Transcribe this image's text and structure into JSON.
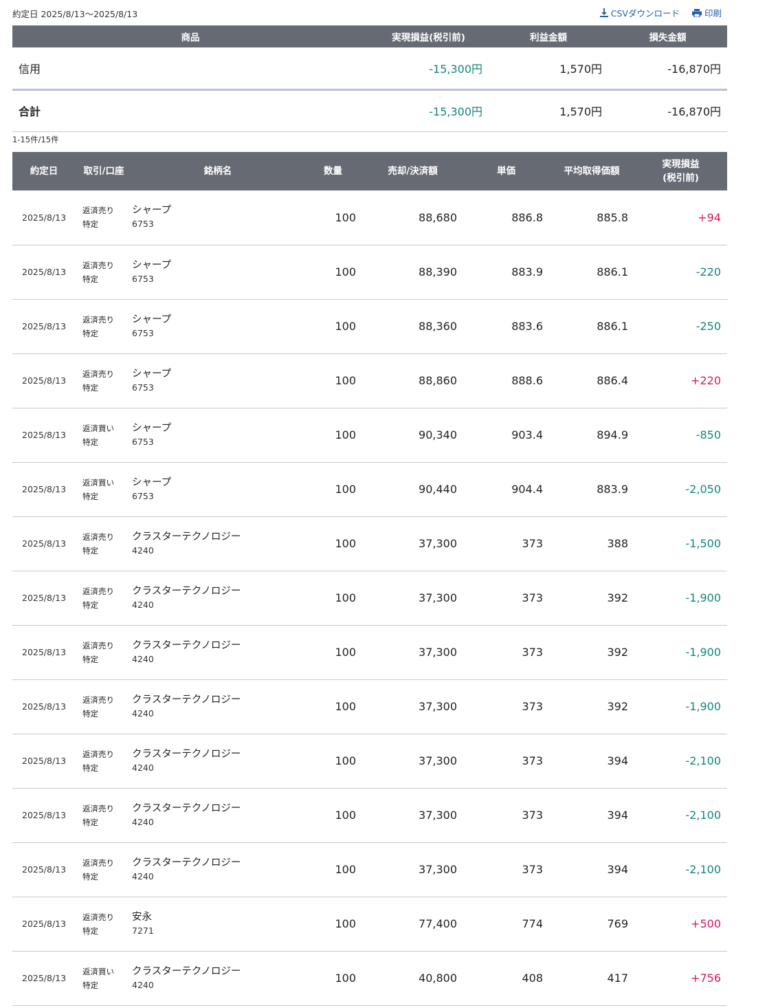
{
  "header": {
    "period": "約定日 2025/8/13〜2025/8/13",
    "csv_label": "CSVダウンロード",
    "print_label": "印刷"
  },
  "summary": {
    "columns": [
      "商品",
      "実現損益(税引前)",
      "利益金額",
      "損失金額"
    ],
    "rows": [
      {
        "label": "信用",
        "realized": "-15,300円",
        "profit": "1,570円",
        "loss": "-16,870円"
      }
    ],
    "total": {
      "label": "合計",
      "realized": "-15,300円",
      "profit": "1,570円",
      "loss": "-16,870円"
    }
  },
  "result_count": "1-15件/15件",
  "detail": {
    "columns": {
      "date": "約定日",
      "type": "取引/口座",
      "name": "銘柄名",
      "qty": "数量",
      "amount": "売却/決済額",
      "price": "単価",
      "avg": "平均取得価額",
      "pl_line1": "実現損益",
      "pl_line2": "(税引前)"
    },
    "rows": [
      {
        "date": "2025/8/13",
        "trade": "返済売り",
        "account": "特定",
        "name": "シャープ",
        "code": "6753",
        "qty": "100",
        "amount": "88,680",
        "price": "886.8",
        "avg": "885.8",
        "pl": "+94",
        "sign": "pos"
      },
      {
        "date": "2025/8/13",
        "trade": "返済売り",
        "account": "特定",
        "name": "シャープ",
        "code": "6753",
        "qty": "100",
        "amount": "88,390",
        "price": "883.9",
        "avg": "886.1",
        "pl": "-220",
        "sign": "neg"
      },
      {
        "date": "2025/8/13",
        "trade": "返済売り",
        "account": "特定",
        "name": "シャープ",
        "code": "6753",
        "qty": "100",
        "amount": "88,360",
        "price": "883.6",
        "avg": "886.1",
        "pl": "-250",
        "sign": "neg"
      },
      {
        "date": "2025/8/13",
        "trade": "返済売り",
        "account": "特定",
        "name": "シャープ",
        "code": "6753",
        "qty": "100",
        "amount": "88,860",
        "price": "888.6",
        "avg": "886.4",
        "pl": "+220",
        "sign": "pos"
      },
      {
        "date": "2025/8/13",
        "trade": "返済買い",
        "account": "特定",
        "name": "シャープ",
        "code": "6753",
        "qty": "100",
        "amount": "90,340",
        "price": "903.4",
        "avg": "894.9",
        "pl": "-850",
        "sign": "neg"
      },
      {
        "date": "2025/8/13",
        "trade": "返済買い",
        "account": "特定",
        "name": "シャープ",
        "code": "6753",
        "qty": "100",
        "amount": "90,440",
        "price": "904.4",
        "avg": "883.9",
        "pl": "-2,050",
        "sign": "neg"
      },
      {
        "date": "2025/8/13",
        "trade": "返済売り",
        "account": "特定",
        "name": "クラスターテクノロジー",
        "code": "4240",
        "qty": "100",
        "amount": "37,300",
        "price": "373",
        "avg": "388",
        "pl": "-1,500",
        "sign": "neg"
      },
      {
        "date": "2025/8/13",
        "trade": "返済売り",
        "account": "特定",
        "name": "クラスターテクノロジー",
        "code": "4240",
        "qty": "100",
        "amount": "37,300",
        "price": "373",
        "avg": "392",
        "pl": "-1,900",
        "sign": "neg"
      },
      {
        "date": "2025/8/13",
        "trade": "返済売り",
        "account": "特定",
        "name": "クラスターテクノロジー",
        "code": "4240",
        "qty": "100",
        "amount": "37,300",
        "price": "373",
        "avg": "392",
        "pl": "-1,900",
        "sign": "neg"
      },
      {
        "date": "2025/8/13",
        "trade": "返済売り",
        "account": "特定",
        "name": "クラスターテクノロジー",
        "code": "4240",
        "qty": "100",
        "amount": "37,300",
        "price": "373",
        "avg": "392",
        "pl": "-1,900",
        "sign": "neg"
      },
      {
        "date": "2025/8/13",
        "trade": "返済売り",
        "account": "特定",
        "name": "クラスターテクノロジー",
        "code": "4240",
        "qty": "100",
        "amount": "37,300",
        "price": "373",
        "avg": "394",
        "pl": "-2,100",
        "sign": "neg"
      },
      {
        "date": "2025/8/13",
        "trade": "返済売り",
        "account": "特定",
        "name": "クラスターテクノロジー",
        "code": "4240",
        "qty": "100",
        "amount": "37,300",
        "price": "373",
        "avg": "394",
        "pl": "-2,100",
        "sign": "neg"
      },
      {
        "date": "2025/8/13",
        "trade": "返済売り",
        "account": "特定",
        "name": "クラスターテクノロジー",
        "code": "4240",
        "qty": "100",
        "amount": "37,300",
        "price": "373",
        "avg": "394",
        "pl": "-2,100",
        "sign": "neg"
      },
      {
        "date": "2025/8/13",
        "trade": "返済売り",
        "account": "特定",
        "name": "安永",
        "code": "7271",
        "qty": "100",
        "amount": "77,400",
        "price": "774",
        "avg": "769",
        "pl": "+500",
        "sign": "pos"
      },
      {
        "date": "2025/8/13",
        "trade": "返済買い",
        "account": "特定",
        "name": "クラスターテクノロジー",
        "code": "4240",
        "qty": "100",
        "amount": "40,800",
        "price": "408",
        "avg": "417",
        "pl": "+756",
        "sign": "pos"
      }
    ]
  },
  "colors": {
    "header_bg": "#666a72",
    "positive": "#d6185f",
    "negative": "#13857a",
    "link": "#1c5fb3"
  },
  "icons": {
    "csv": "download-icon",
    "print": "printer-icon"
  }
}
